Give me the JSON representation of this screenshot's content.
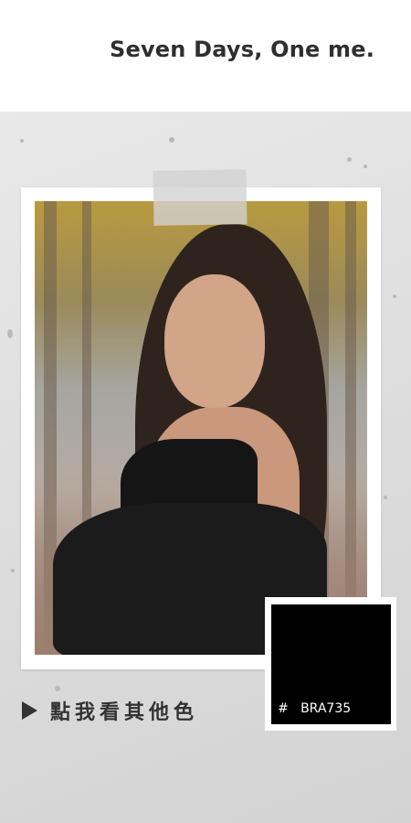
{
  "header": {
    "title": "Seven Days, One me."
  },
  "swatch": {
    "color_hex": "#000000",
    "code": "#   BRA735"
  },
  "link": {
    "label": "點我看其他色",
    "icon": "play-triangle-icon"
  },
  "colors": {
    "panel_bg": "#dedede",
    "frame": "#ffffff",
    "text_dark": "#333333"
  }
}
